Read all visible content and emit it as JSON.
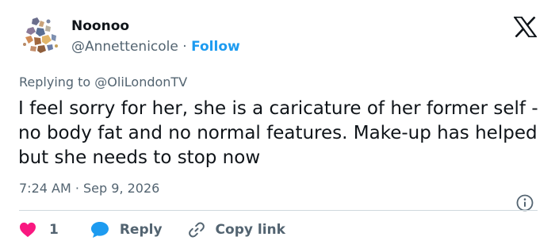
{
  "author": {
    "display_name": "Noonoo",
    "handle": "@Annettenicole",
    "separator": "·",
    "follow_label": "Follow"
  },
  "reply_context": {
    "prefix": "Replying to",
    "mention": "@OliLondonTV"
  },
  "tweet": {
    "text": "I feel sorry for her, she is a caricature of her former self - no body fat and no normal features. Make-up has helped but she needs to stop now",
    "timestamp": "7:24 AM · Sep 9, 2026"
  },
  "actions": {
    "like_count": "1",
    "reply_label": "Reply",
    "copy_link_label": "Copy link"
  },
  "icons": {
    "brand": "x-logo-icon",
    "info": "info-icon",
    "like": "heart-icon",
    "reply": "speech-bubble-icon",
    "copy": "link-icon"
  },
  "colors": {
    "accent": "#1d9bf0",
    "like": "#f91880",
    "text_primary": "#0f1419",
    "text_secondary": "#536471",
    "divider": "#cfd9de"
  }
}
